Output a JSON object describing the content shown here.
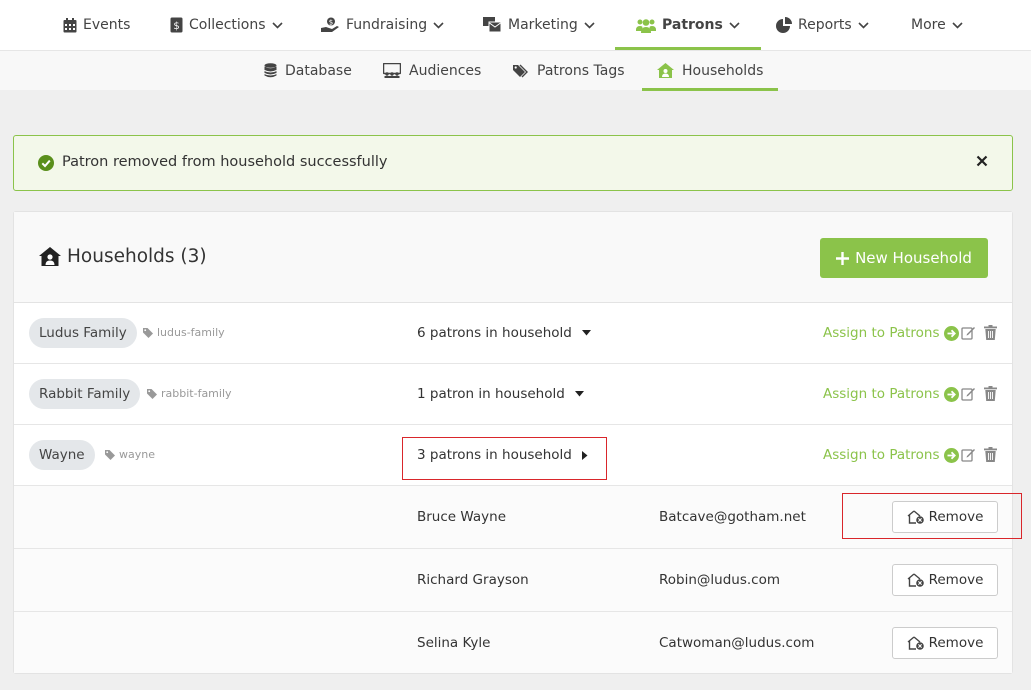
{
  "topnav": {
    "items": [
      {
        "label": "Events",
        "icon": "calendar-icon"
      },
      {
        "label": "Collections",
        "icon": "phone-dollar-icon"
      },
      {
        "label": "Fundraising",
        "icon": "hand-holding-dollar-icon"
      },
      {
        "label": "Marketing",
        "icon": "mail-bulk-icon"
      },
      {
        "label": "Patrons",
        "icon": "users-icon"
      },
      {
        "label": "Reports",
        "icon": "pie-chart-icon"
      },
      {
        "label": "More",
        "icon": ""
      }
    ],
    "active": "Patrons"
  },
  "subnav": {
    "items": [
      {
        "label": "Database",
        "icon": "database-icon"
      },
      {
        "label": "Audiences",
        "icon": "audience-icon"
      },
      {
        "label": "Patrons Tags",
        "icon": "tags-icon"
      },
      {
        "label": "Households",
        "icon": "house-user-icon"
      }
    ],
    "active": "Households"
  },
  "alert": {
    "message": "Patron removed from household successfully"
  },
  "panel": {
    "title": "Households (3)",
    "new_button": "New Household"
  },
  "households": [
    {
      "name": "Ludus Family",
      "slug": "ludus-family",
      "count": "6 patrons in household",
      "assign": "Assign to Patrons",
      "expanded": false
    },
    {
      "name": "Rabbit Family",
      "slug": "rabbit-family",
      "count": "1 patron in household",
      "assign": "Assign to Patrons",
      "expanded": false
    },
    {
      "name": "Wayne",
      "slug": "wayne",
      "count": "3 patrons in household",
      "assign": "Assign to Patrons",
      "expanded": true
    }
  ],
  "patrons": [
    {
      "name": "Bruce Wayne",
      "email": "Batcave@gotham.net",
      "remove": "Remove"
    },
    {
      "name": "Richard Grayson",
      "email": "Robin@ludus.com",
      "remove": "Remove"
    },
    {
      "name": "Selina Kyle",
      "email": "Catwoman@ludus.com",
      "remove": "Remove"
    }
  ],
  "colors": {
    "accent": "#8bc34a",
    "highlight": "#d9262b"
  }
}
